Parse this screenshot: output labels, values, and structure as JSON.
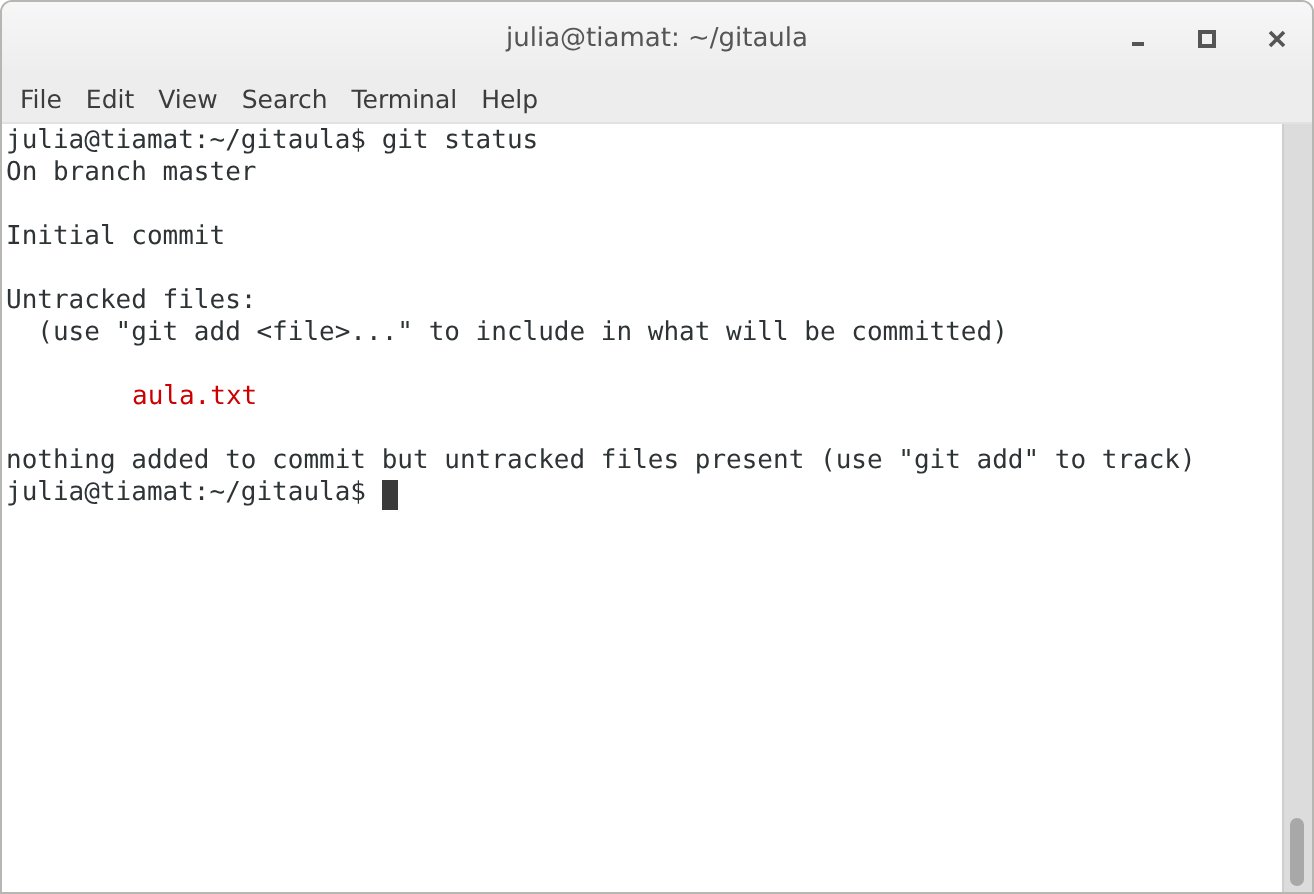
{
  "window": {
    "title": "julia@tiamat: ~/gitaula"
  },
  "menu": [
    "File",
    "Edit",
    "View",
    "Search",
    "Terminal",
    "Help"
  ],
  "lines": [
    {
      "kind": "output",
      "text": "julia@tiamat:~/gitaula$ git status"
    },
    {
      "kind": "output",
      "text": "On branch master"
    },
    {
      "kind": "blank"
    },
    {
      "kind": "output",
      "text": "Initial commit"
    },
    {
      "kind": "blank"
    },
    {
      "kind": "output",
      "text": "Untracked files:"
    },
    {
      "kind": "output",
      "text": "  (use \"git add <file>...\" to include in what will be committed)"
    },
    {
      "kind": "blank"
    },
    {
      "kind": "untracked",
      "text": "aula.txt"
    },
    {
      "kind": "blank"
    },
    {
      "kind": "output",
      "text": "nothing added to commit but untracked files present (use \"git add\" to track)"
    },
    {
      "kind": "prompt",
      "text": "julia@tiamat:~/gitaula$",
      "cursor": true
    }
  ]
}
